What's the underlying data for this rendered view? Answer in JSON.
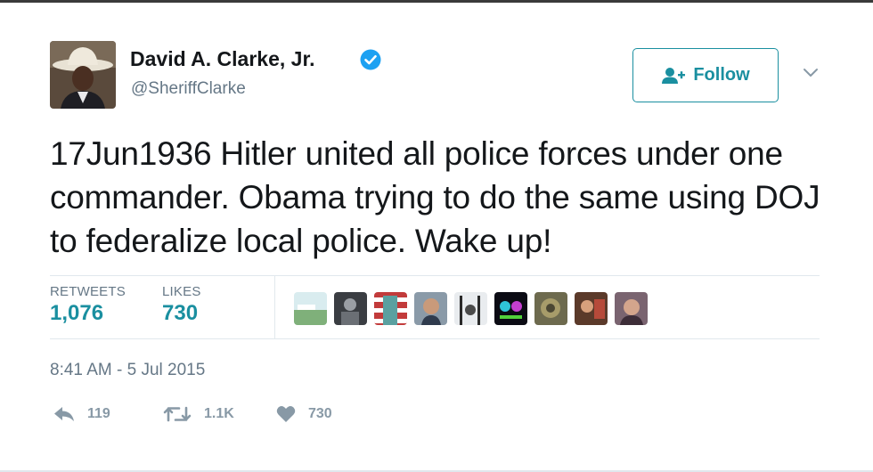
{
  "author": {
    "display_name": "David A. Clarke, Jr.",
    "handle": "@SheriffClarke",
    "verified": true,
    "avatar": "cowboy-hat-portrait"
  },
  "follow_button": {
    "label": "Follow",
    "icon": "add-user-icon"
  },
  "menu": {
    "icon": "chevron-down-icon"
  },
  "tweet": {
    "text": "17Jun1936 Hitler united all police forces under one commander. Obama trying to do the same using DOJ to federalize local police. Wake up!"
  },
  "stats": {
    "retweets_label": "RETWEETS",
    "retweets_value": "1,076",
    "likes_label": "LIKES",
    "likes_value": "730",
    "liker_avatar_count": 9
  },
  "timestamp": "8:41 AM - 5 Jul 2015",
  "actions": {
    "reply_count": "119",
    "retweet_count": "1.1K",
    "like_count": "730"
  },
  "colors": {
    "accent": "#1a8fa0",
    "verified": "#1da1f2",
    "muted": "#657786",
    "action_gray": "#8899a6"
  }
}
